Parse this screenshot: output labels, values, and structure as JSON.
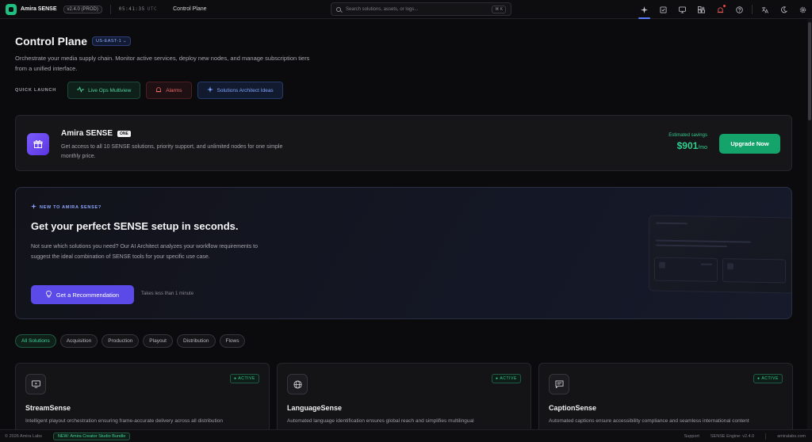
{
  "topbar": {
    "brand": "Amira SENSE",
    "version": "v2.4.0 (PROD)",
    "clock": "05:41:35",
    "timezone": "UTC",
    "page_label": "Control Plane",
    "search_placeholder": "Search solutions, assets, or logs...",
    "search_shortcut": "⌘ K",
    "icons": [
      "sparkle-icon",
      "checklist-icon",
      "monitor-icon",
      "grid-plus-icon",
      "alarm-icon",
      "help-icon",
      "translate-icon",
      "theme-icon",
      "settings-icon"
    ]
  },
  "header": {
    "title": "Control Plane",
    "region": "US-EAST-1 ⌄",
    "description": "Orchestrate your media supply chain. Monitor active services, deploy new nodes, and manage subscription tiers from a unified interface."
  },
  "quick_launch": {
    "label": "QUICK LAUNCH",
    "buttons": [
      {
        "label": "Live Ops Multiview",
        "icon": "pulse-icon",
        "color": "#4fd6a0"
      },
      {
        "label": "Alarms",
        "icon": "bell-icon",
        "color": "#f06a6a"
      },
      {
        "label": "Solutions Architect Ideas",
        "icon": "sparkle-icon",
        "color": "#7ea5ff"
      }
    ]
  },
  "upgrade": {
    "title": "Amira SENSE",
    "badge": "ONE",
    "description": "Get access to all 10 SENSE solutions, priority support, and unlimited nodes for one simple monthly price.",
    "savings_label": "Estimated savings",
    "savings_amount": "$901",
    "savings_period": "/mo",
    "button": "Upgrade Now"
  },
  "onboarding": {
    "kicker": "NEW TO AMIRA SENSE?",
    "title": "Get your perfect SENSE setup in seconds.",
    "description": "Not sure which solutions you need? Our AI Architect analyzes your workflow requirements to suggest the ideal combination of SENSE tools for your specific use case.",
    "button": "Get a Recommendation",
    "note": "Takes less than 1 minute"
  },
  "filters": [
    "All Solutions",
    "Acquisition",
    "Production",
    "Playout",
    "Distribution",
    "Flows"
  ],
  "solutions": [
    {
      "name": "StreamSense",
      "status": "● ACTIVE",
      "icon": "monitor-play-icon",
      "description": "Intelligent playout orchestration ensuring frame-accurate delivery across all distribution"
    },
    {
      "name": "LanguageSense",
      "status": "● ACTIVE",
      "icon": "globe-icon",
      "description": "Automated language identification ensures global reach and simplifies multilingual"
    },
    {
      "name": "CaptionSense",
      "status": "● ACTIVE",
      "icon": "caption-icon",
      "description": "Automated captions ensure accessibility compliance and seamless international content"
    }
  ],
  "footer": {
    "copyright": "© 2026 Amira Labs",
    "bundle": "NEW: Amira Creator Studio Bundle",
    "support": "Support",
    "engine": "SENSE Engine: v2.4.0",
    "domain": "amiralabs.com"
  }
}
